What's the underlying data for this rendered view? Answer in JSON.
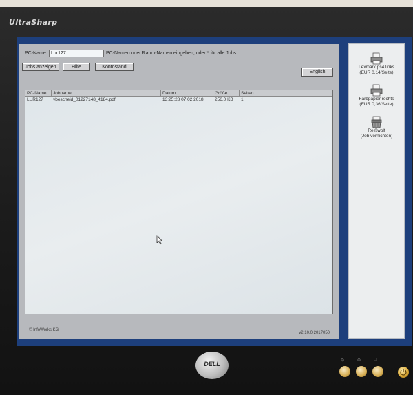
{
  "monitor": {
    "brand": "UltraSharp",
    "logo": "DELL",
    "button_labels": [
      "⊖",
      "⊕",
      "□"
    ],
    "power_icon": "power-icon"
  },
  "app": {
    "pc_name_label": "PC-Name:",
    "pc_name_value": "Lur127",
    "hint": "PC-Namen oder Raum-Namen eingeben, oder * für alle Jobs",
    "buttons": {
      "show_jobs": "Jobs anzeigen",
      "help": "Hilfe",
      "balance": "Kontostand",
      "language": "English"
    },
    "table": {
      "headers": [
        "PC-Name",
        "Jobname",
        "Datum",
        "Größe",
        "Seiten"
      ],
      "rows": [
        [
          "LUR127",
          "vbescheid_01227148_4184.pdf",
          "13:25:28 07.02.2018",
          "256.0 KB",
          "1"
        ]
      ]
    },
    "copyright": "© InfoWorks KG",
    "version": "v2.10.0 2017050"
  },
  "side_panel": {
    "items": [
      {
        "icon": "printer-icon",
        "line1": "Lexmark ps4 links",
        "line2": "(EUR 0,14/Seite)"
      },
      {
        "icon": "printer-icon",
        "line1": "Farbpapier rechts",
        "line2": "(EUR 0,36/Seite)"
      },
      {
        "icon": "shredder-icon",
        "line1": "Reißwolf",
        "line2": "(Job vernichten)"
      }
    ]
  }
}
